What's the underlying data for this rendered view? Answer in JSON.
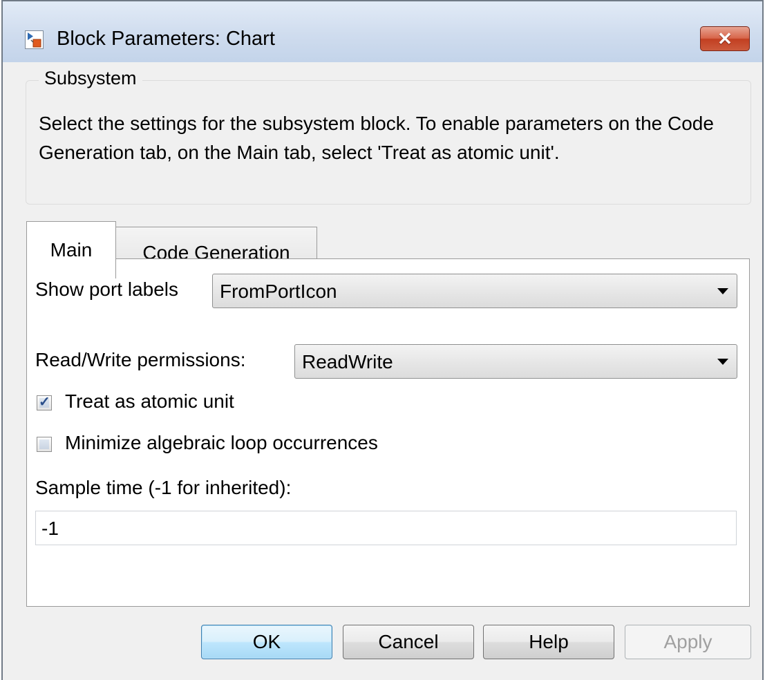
{
  "window": {
    "title": "Block Parameters: Chart",
    "close_label": "✕"
  },
  "group": {
    "title": "Subsystem",
    "description": "Select the settings for the subsystem block. To enable parameters on the Code Generation tab, on the Main tab, select 'Treat as atomic unit'."
  },
  "tabs": [
    {
      "label": "Main",
      "selected": true
    },
    {
      "label": "Code Generation",
      "selected": false
    }
  ],
  "main": {
    "show_port_labels": {
      "label": "Show port labels",
      "value": "FromPortIcon"
    },
    "read_write": {
      "label": "Read/Write permissions:",
      "value": "ReadWrite"
    },
    "treat_atomic": {
      "label": "Treat as atomic unit",
      "checked": true
    },
    "minimize_loop": {
      "label": "Minimize algebraic loop occurrences",
      "checked": false
    },
    "sample_time": {
      "label": "Sample time (-1 for inherited):",
      "value": "-1"
    }
  },
  "buttons": {
    "ok": "OK",
    "cancel": "Cancel",
    "help": "Help",
    "apply": "Apply"
  }
}
